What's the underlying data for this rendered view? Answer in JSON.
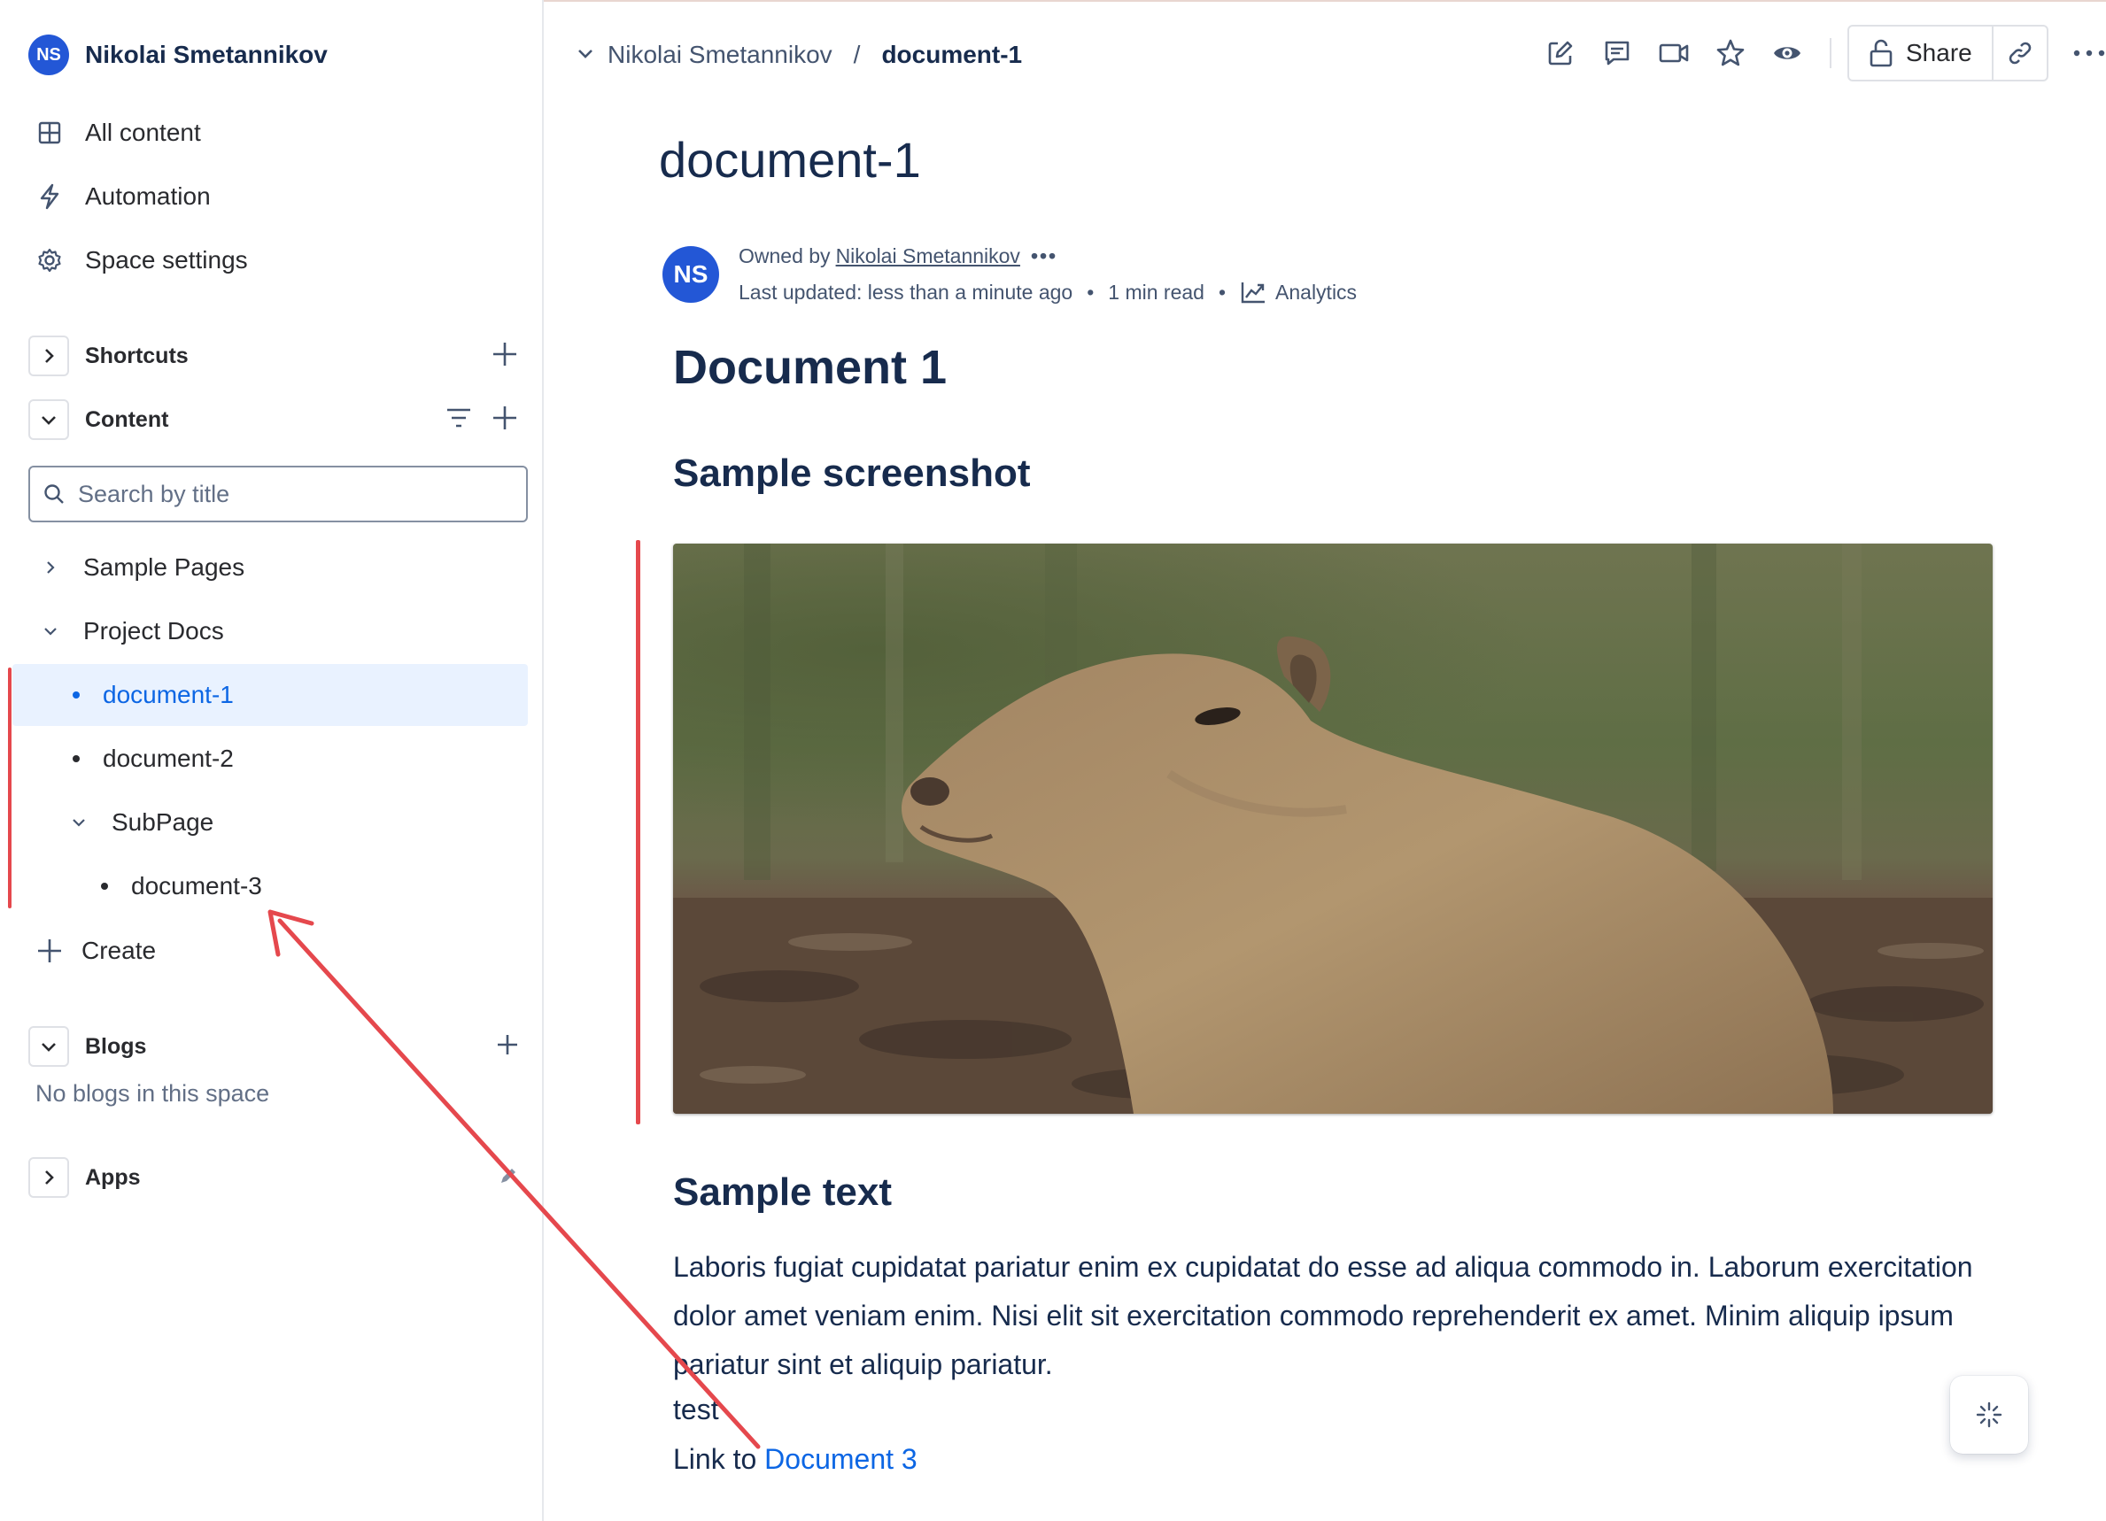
{
  "sidebar": {
    "space_initials": "NS",
    "space_name": "Nikolai Smetannikov",
    "nav": [
      {
        "label": "All content",
        "icon": "grid-icon"
      },
      {
        "label": "Automation",
        "icon": "lightning-icon"
      },
      {
        "label": "Space settings",
        "icon": "gear-icon"
      }
    ],
    "shortcuts_label": "Shortcuts",
    "content_label": "Content",
    "search_placeholder": "Search by title",
    "tree": [
      {
        "label": "Sample Pages",
        "type": "collapsed"
      },
      {
        "label": "Project Docs",
        "type": "expanded"
      },
      {
        "label": "document-1",
        "type": "page",
        "selected": true
      },
      {
        "label": "document-2",
        "type": "page"
      },
      {
        "label": "SubPage",
        "type": "expanded"
      },
      {
        "label": "document-3",
        "type": "page"
      }
    ],
    "create_label": "Create",
    "blogs_label": "Blogs",
    "blogs_empty": "No blogs in this space",
    "apps_label": "Apps"
  },
  "header": {
    "breadcrumb_space": "Nikolai Smetannikov",
    "breadcrumb_sep": "/",
    "breadcrumb_page": "document-1",
    "share_label": "Share",
    "icons": [
      "edit-icon",
      "comment-icon",
      "video-icon",
      "star-icon",
      "watch-icon",
      "lock-icon",
      "link-icon",
      "more-icon"
    ]
  },
  "page": {
    "title": "document-1",
    "owner_initials": "NS",
    "owned_by": "Owned by",
    "owner_name": "Nikolai Smetannikov",
    "owner_more": "•••",
    "last_updated": "Last updated: less than a minute ago",
    "dot": "•",
    "read_time": "1 min read",
    "analytics": "Analytics",
    "heading1": "Document 1",
    "heading_screenshot": "Sample screenshot",
    "heading_text": "Sample text",
    "paragraph": "Laboris fugiat cupidatat pariatur enim ex cupidatat do esse ad aliqua commodo in. Laborum exercitation dolor amet veniam enim. Nisi elit sit exercitation commodo reprehenderit ex amet. Minim aliquip ipsum pariatur sint et aliquip pariatur.",
    "test_line": "test",
    "link_prefix": "Link to ",
    "link_text": "Document 3"
  },
  "colors": {
    "accent": "#0c66e4",
    "avatar": "#2357d6",
    "annotation": "#e5484d",
    "selected_bg": "#e9f2ff"
  }
}
